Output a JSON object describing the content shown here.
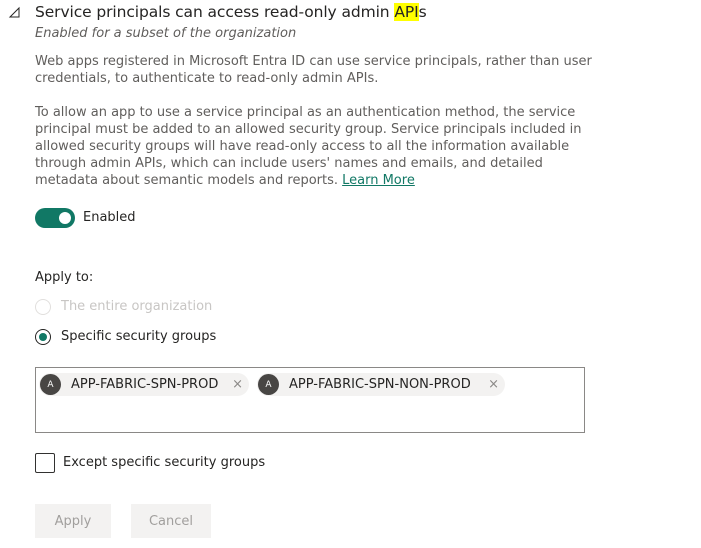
{
  "setting": {
    "title_pre": "Service principals can access read-only admin ",
    "title_highlight": "API",
    "title_post": "s",
    "subtitle": "Enabled for a subset of the organization",
    "description_1": "Web apps registered in Microsoft Entra ID can use service principals, rather than user credentials, to authenticate to read-only admin APIs.",
    "description_2": "To allow an app to use a service principal as an authentication method, the service principal must be added to an allowed security group. Service principals included in allowed security groups will have read-only access to all the information available through admin APIs, which can include users' names and emails, and detailed metadata about semantic models and reports. ",
    "learn_more": "Learn More"
  },
  "toggle": {
    "label": "Enabled",
    "on": true
  },
  "apply_to": {
    "label": "Apply to:",
    "options": [
      {
        "label": "The entire organization",
        "selected": false,
        "disabled": true
      },
      {
        "label": "Specific security groups",
        "selected": true,
        "disabled": false
      }
    ]
  },
  "groups": [
    {
      "initial": "A",
      "name": "APP-FABRIC-SPN-PROD",
      "remove": "×"
    },
    {
      "initial": "A",
      "name": "APP-FABRIC-SPN-NON-PROD",
      "remove": "×"
    }
  ],
  "except": {
    "label": "Except specific security groups",
    "checked": false
  },
  "buttons": {
    "apply": "Apply",
    "cancel": "Cancel"
  },
  "colors": {
    "accent": "#117865",
    "highlight": "#ffff00",
    "disabled_text": "#c8c6c4"
  }
}
